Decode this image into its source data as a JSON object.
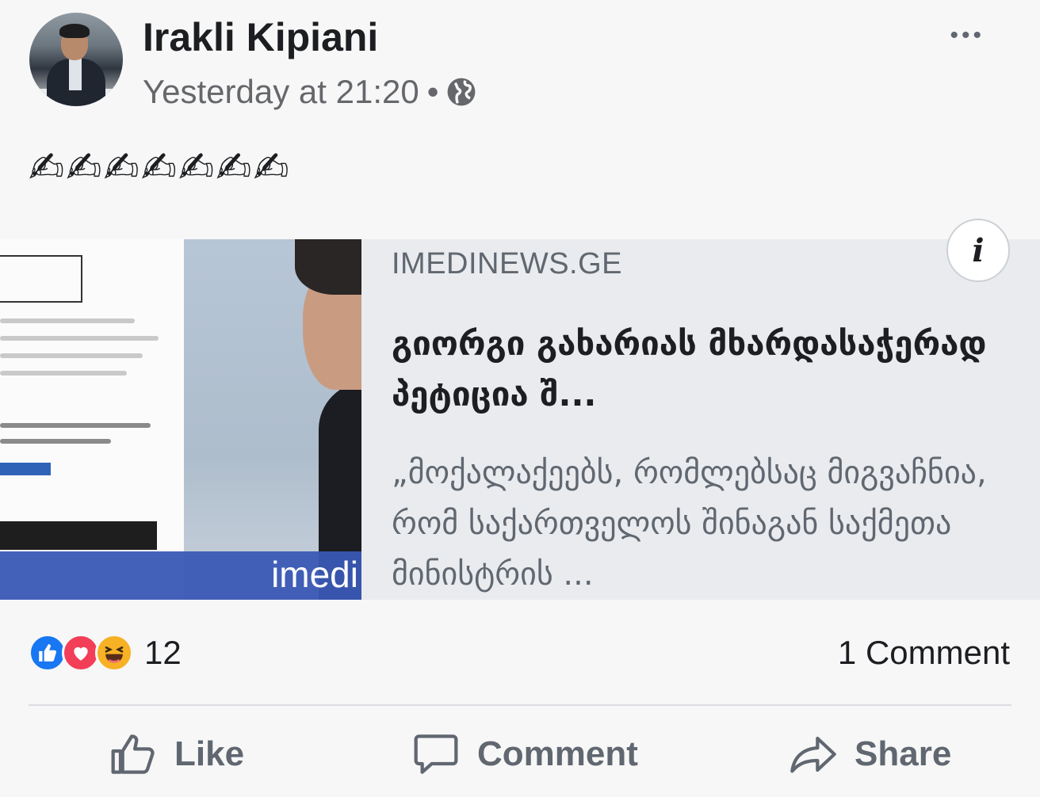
{
  "post": {
    "author": "Irakli Kipiani",
    "timestamp": "Yesterday at 21:20",
    "separator": "•",
    "audience_icon": "globe-icon",
    "more_label": "•••",
    "message": "✍✍✍✍✍✍✍"
  },
  "link": {
    "site": "IMEDINEWS.GE",
    "headline": "გიორგი გახარიას მხარდასაჭერად პეტიცია შ...",
    "snippet": "„მოქალაქეებს, რომლებსაც მიგვაჩნია, რომ საქართველოს შინაგან საქმეთა მინისტრის ...",
    "thumb_brand": "imedi",
    "info_label": "i"
  },
  "reactions": {
    "types": [
      "like",
      "love",
      "haha"
    ],
    "count": "12",
    "comments": "1 Comment"
  },
  "actions": {
    "like": "Like",
    "comment": "Comment",
    "share": "Share"
  },
  "colors": {
    "like_blue": "#1877f2",
    "love_red": "#f33e58",
    "haha_yellow": "#f7b125",
    "muted_text": "#606770"
  }
}
